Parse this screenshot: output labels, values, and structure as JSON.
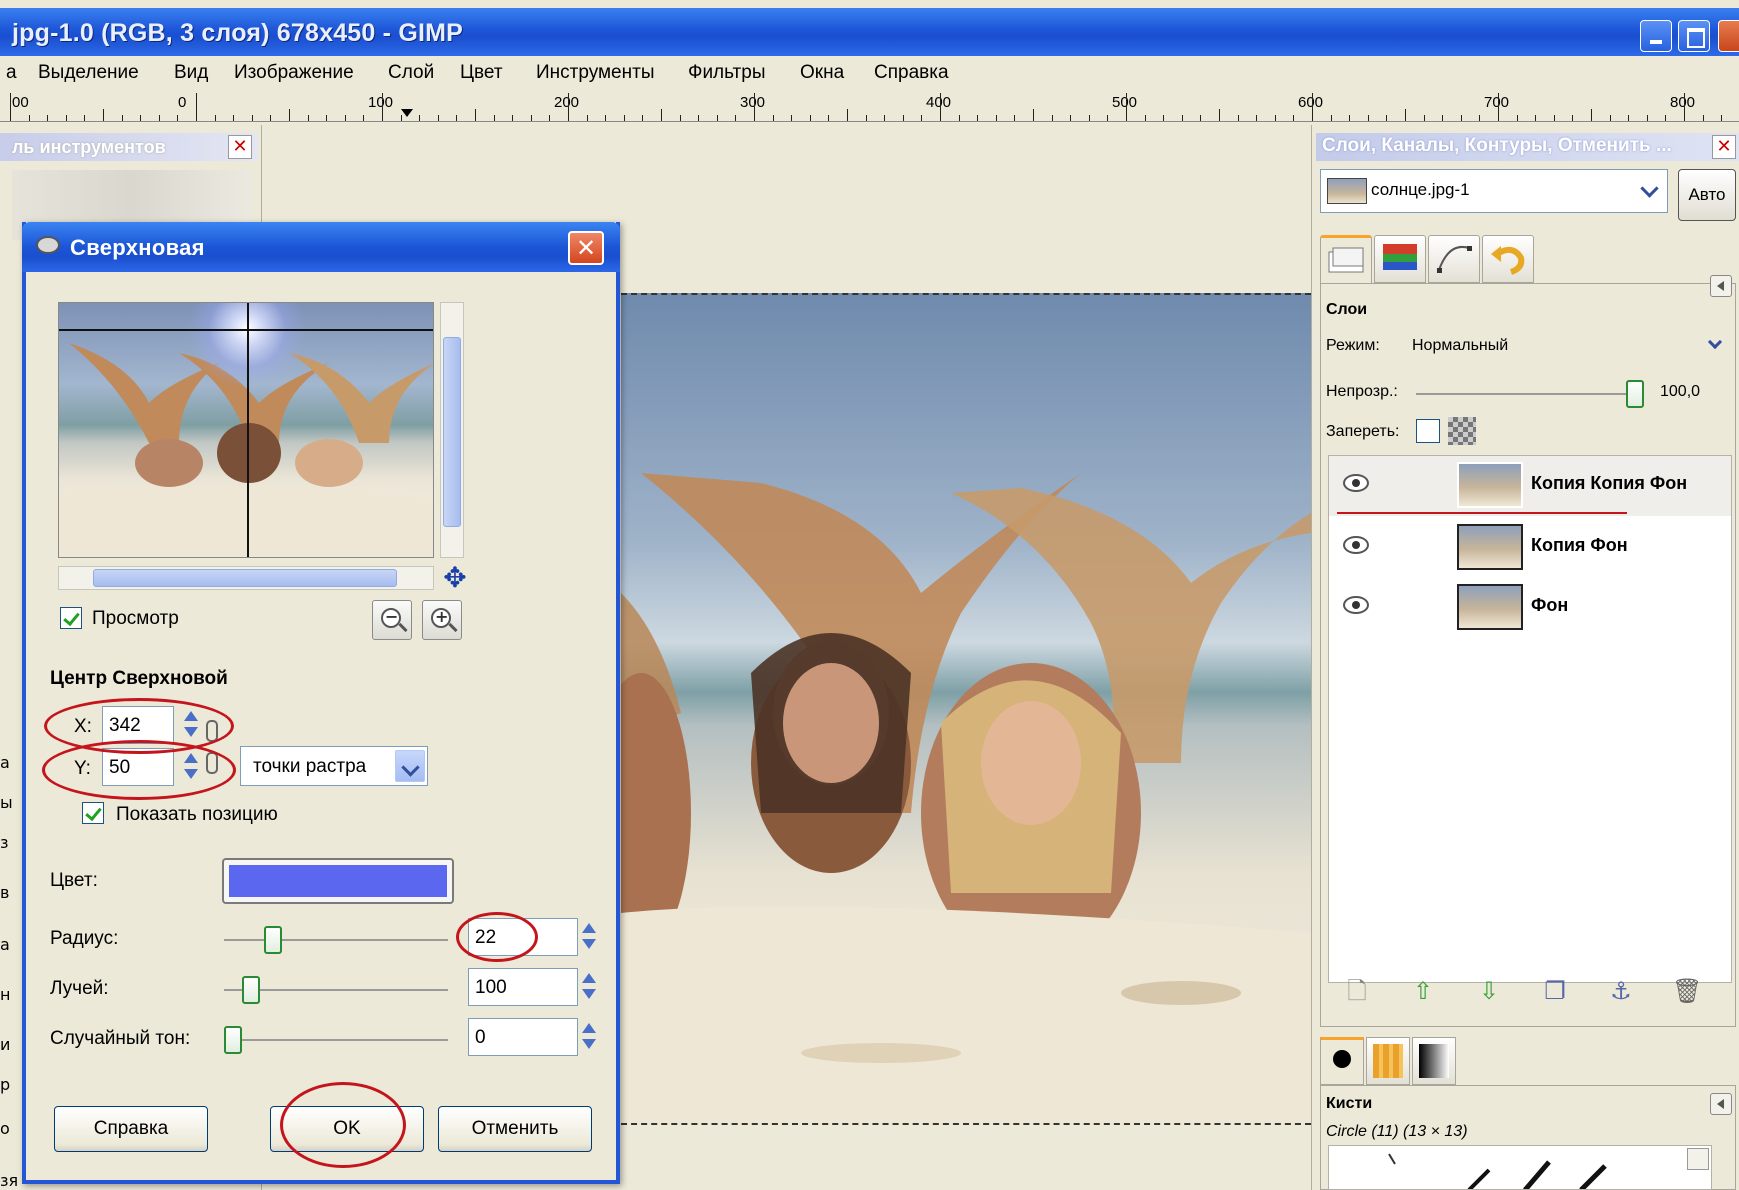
{
  "window": {
    "title": "jpg-1.0 (RGB, 3 слоя) 678x450 - GIMP"
  },
  "menu": {
    "cut_first": "а",
    "items": [
      "Выделение",
      "Вид",
      "Изображение",
      "Слой",
      "Цвет",
      "Инструменты",
      "Фильтры",
      "Окна",
      "Справка"
    ]
  },
  "ruler": {
    "labels": [
      "00",
      "0",
      "100",
      "200",
      "300",
      "400",
      "500",
      "600",
      "700",
      "800"
    ]
  },
  "toolbox": {
    "title": "ль инструментов",
    "close": "✕"
  },
  "left_clip_chars": [
    "а",
    "ы",
    "з",
    "в",
    "а",
    "н",
    "и",
    "р",
    "о",
    "зя"
  ],
  "dialog": {
    "title": "Сверхновая",
    "close": "✕",
    "preview_label": "Просмотр",
    "section_title": "Центр Сверхновой",
    "x_label": "X:",
    "x_value": "342",
    "y_label": "Y:",
    "y_value": "50",
    "unit": "точки растра",
    "show_position_label": "Показать позицию",
    "color_label": "Цвет:",
    "color_value": "#5b67ee",
    "radius_label": "Радиус:",
    "radius_value": "22",
    "rays_label": "Лучей:",
    "rays_value": "100",
    "random_hue_label": "Случайный тон:",
    "random_hue_value": "0",
    "help_button": "Справка",
    "ok_button": "OK",
    "cancel_button": "Отменить"
  },
  "dock": {
    "title": "Слои, Каналы, Контуры, Отменить ...",
    "close": "✕",
    "image_name": "солнце.jpg-1",
    "auto_button": "Авто",
    "layers_header": "Слои",
    "mode_label": "Режим:",
    "mode_value": "Нормальный",
    "opacity_label": "Непрозр.:",
    "opacity_value": "100,0",
    "lock_label": "Запереть:",
    "layers": [
      {
        "name": "Копия Копия Фон",
        "selected": true
      },
      {
        "name": "Копия Фон",
        "selected": false
      },
      {
        "name": "Фон",
        "selected": false
      }
    ],
    "brushes_header": "Кисти",
    "brush_name": "Circle (11) (13 × 13)"
  },
  "colors": {
    "title_bar": "#1d56d8",
    "highlight_circle": "#c4151c",
    "supernova_color": "#5b67ee"
  }
}
